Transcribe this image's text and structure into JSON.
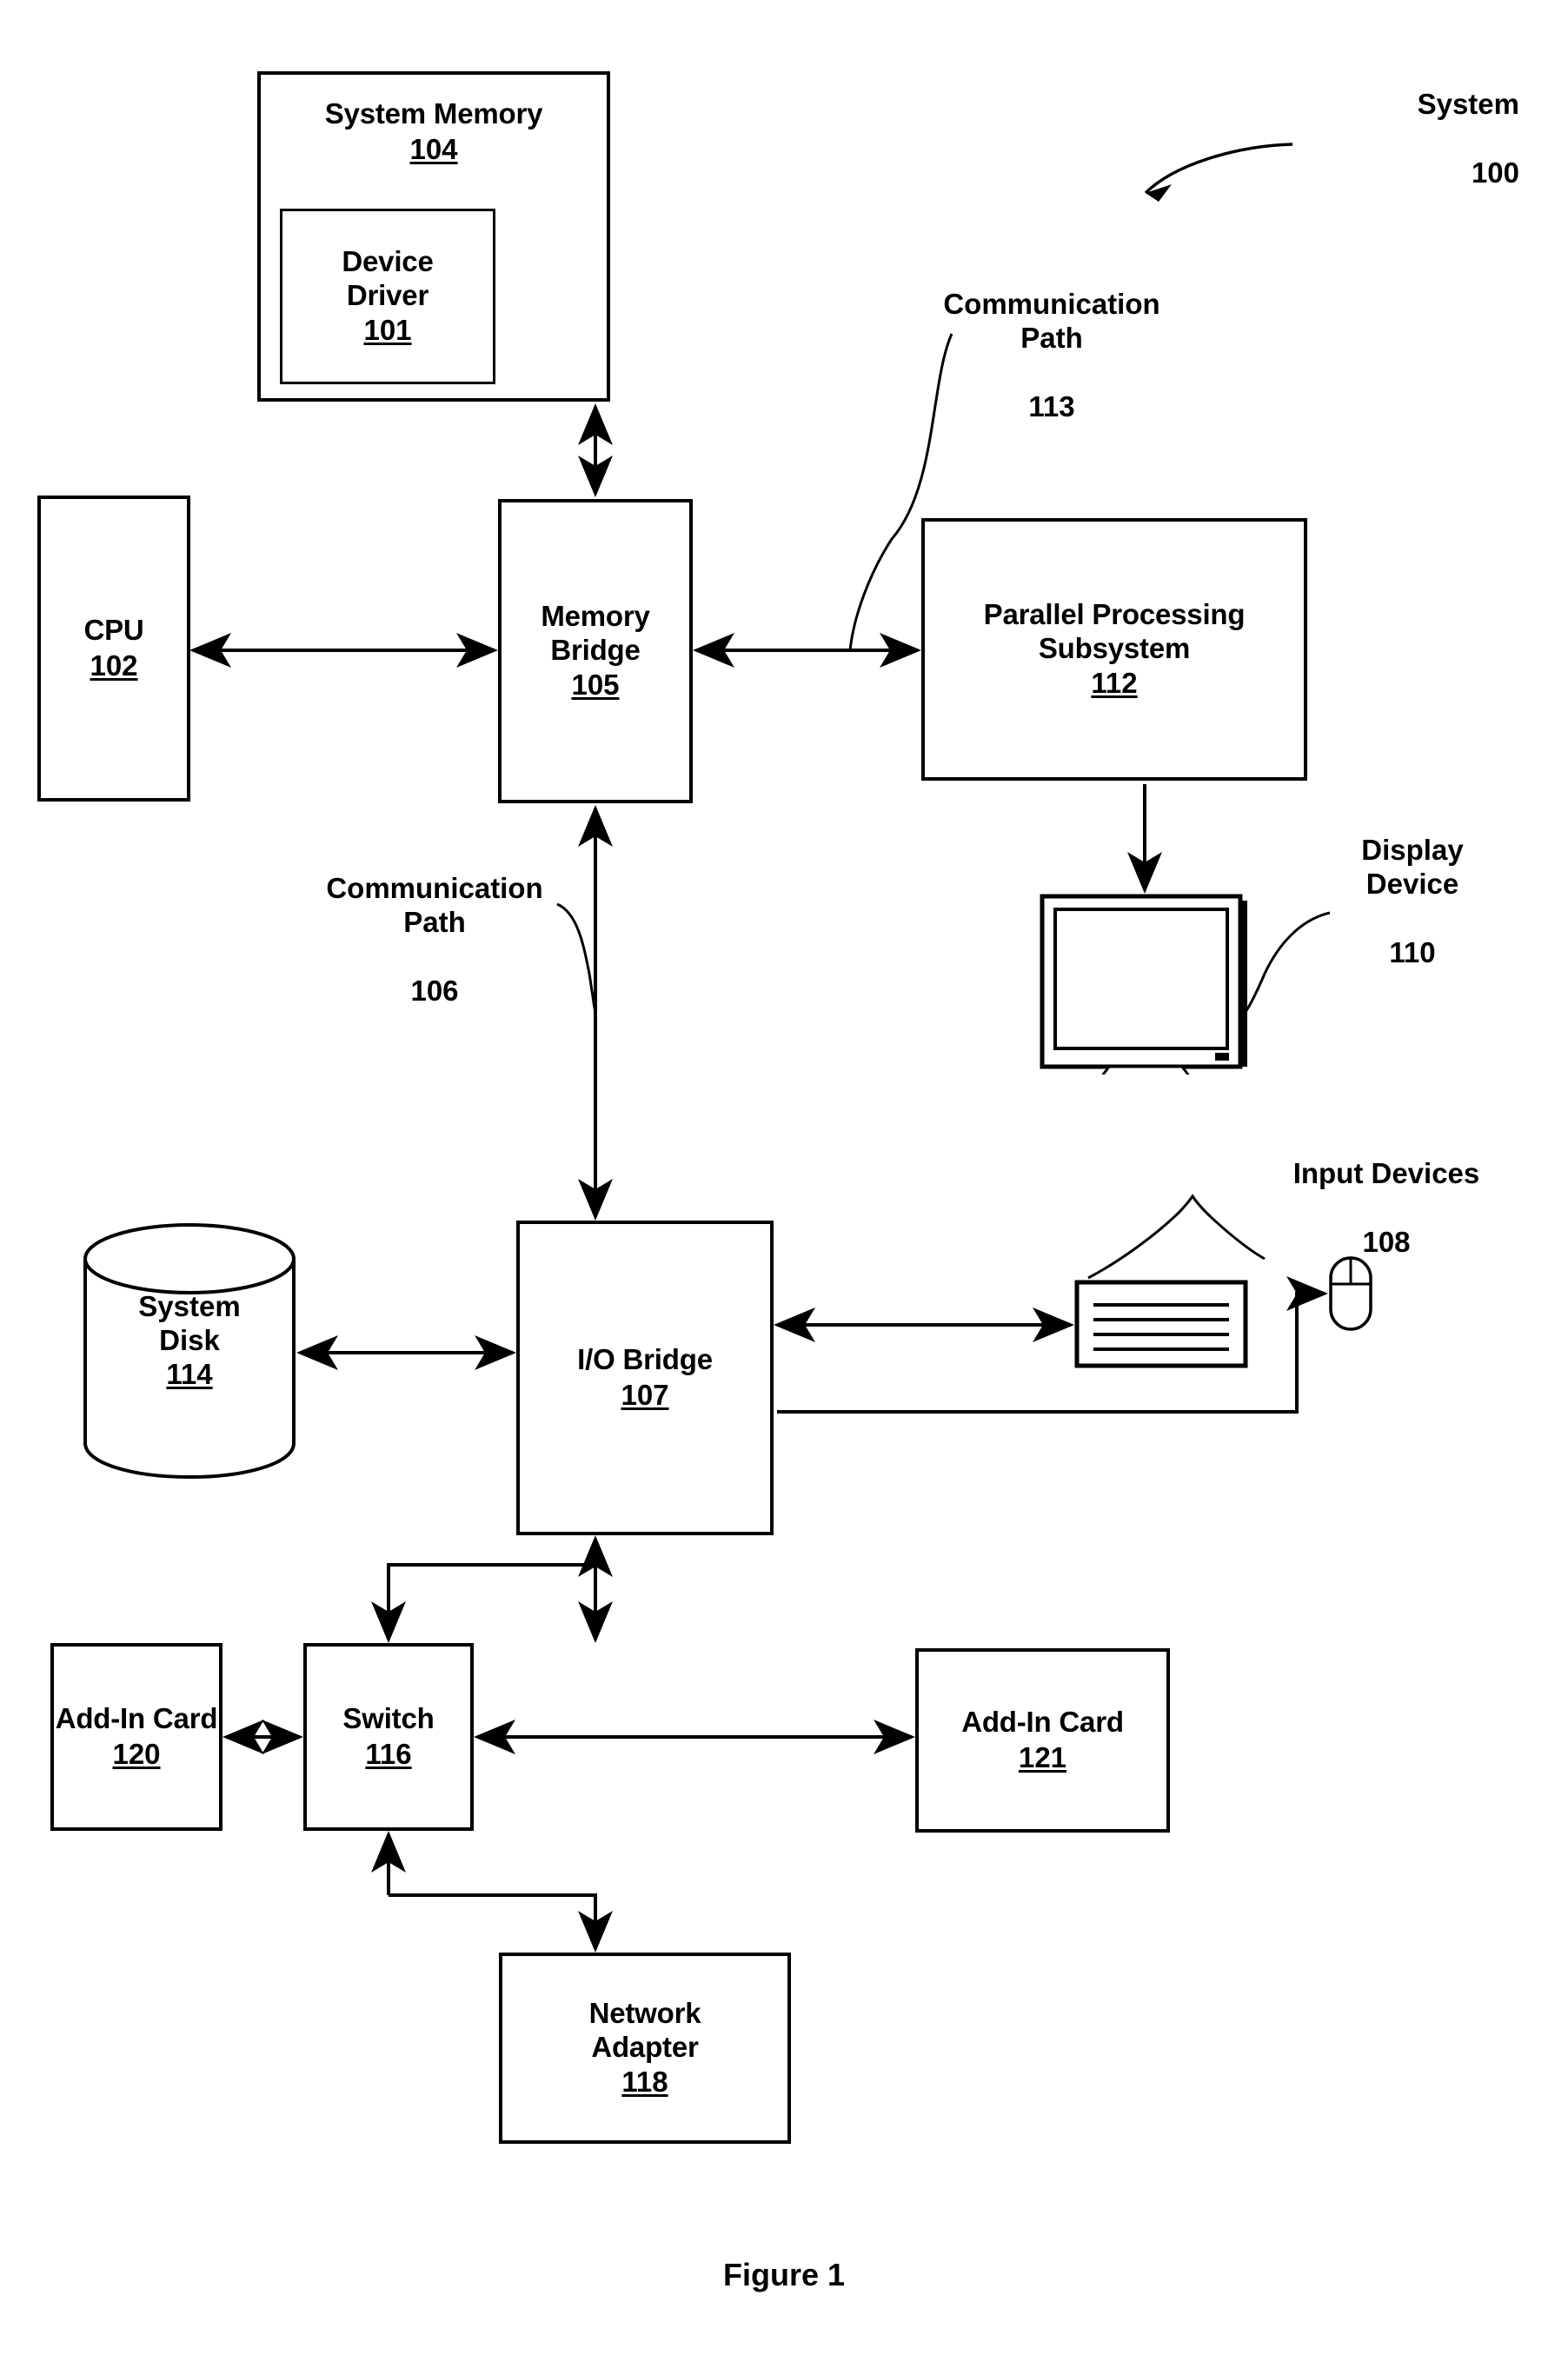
{
  "figure": {
    "caption": "Figure 1",
    "system_callout": {
      "label": "System",
      "ref": "100"
    }
  },
  "nodes": {
    "system_memory": {
      "title": "System Memory",
      "ref": "104",
      "name": "system-memory"
    },
    "device_driver": {
      "title": "Device\nDriver",
      "ref": "101",
      "name": "device-driver"
    },
    "cpu": {
      "title": "CPU",
      "ref": "102",
      "name": "cpu"
    },
    "memory_bridge": {
      "title": "Memory\nBridge",
      "ref": "105",
      "name": "memory-bridge"
    },
    "parallel_processing_subsystem": {
      "title": "Parallel Processing\nSubsystem",
      "ref": "112",
      "name": "parallel-processing-subsystem"
    },
    "io_bridge": {
      "title": "I/O Bridge",
      "ref": "107",
      "name": "io-bridge"
    },
    "system_disk": {
      "title": "System\nDisk",
      "ref": "114",
      "name": "system-disk"
    },
    "switch": {
      "title": "Switch",
      "ref": "116",
      "name": "switch"
    },
    "add_in_card_120": {
      "title": "Add-In Card",
      "ref": "120",
      "name": "add-in-card-120"
    },
    "add_in_card_121": {
      "title": "Add-In Card",
      "ref": "121",
      "name": "add-in-card-121"
    },
    "network_adapter": {
      "title": "Network\nAdapter",
      "ref": "118",
      "name": "network-adapter"
    }
  },
  "callouts": {
    "communication_path_113": {
      "label": "Communication\nPath",
      "ref": "113"
    },
    "communication_path_106": {
      "label": "Communication\nPath",
      "ref": "106"
    },
    "display_device": {
      "label": "Display\nDevice",
      "ref": "110"
    },
    "input_devices": {
      "label": "Input Devices",
      "ref": "108"
    }
  },
  "icons": {
    "display_device": "monitor-icon",
    "keyboard": "keyboard-icon",
    "mouse": "mouse-icon",
    "system_disk": "cylinder-disk-icon"
  },
  "colors": {
    "stroke": "#000000",
    "background": "#ffffff"
  }
}
